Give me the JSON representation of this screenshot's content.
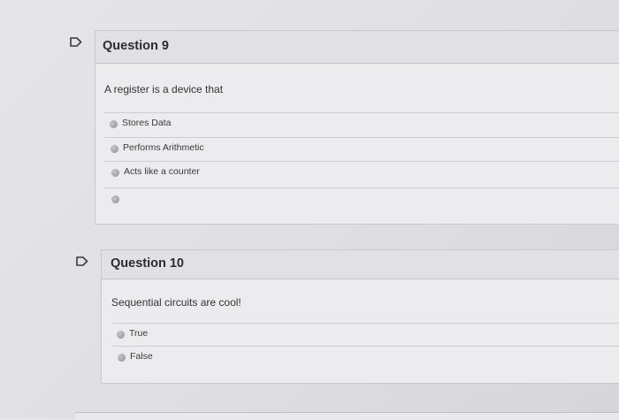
{
  "questions": [
    {
      "title": "Question 9",
      "prompt": "A register is a device that",
      "options": [
        "Stores Data",
        "Performs Arithmetic",
        "Acts like a counter",
        ""
      ]
    },
    {
      "title": "Question 10",
      "prompt": "Sequential circuits are cool!",
      "options": [
        "True",
        "False"
      ]
    }
  ],
  "colors": {
    "flag_stroke": "#3a3a3a",
    "radio": "#9ea0a3",
    "header_bg": "#e1e1e5"
  },
  "icons": {
    "flag": "flag-outline-icon",
    "radio": "radio-button-icon"
  }
}
